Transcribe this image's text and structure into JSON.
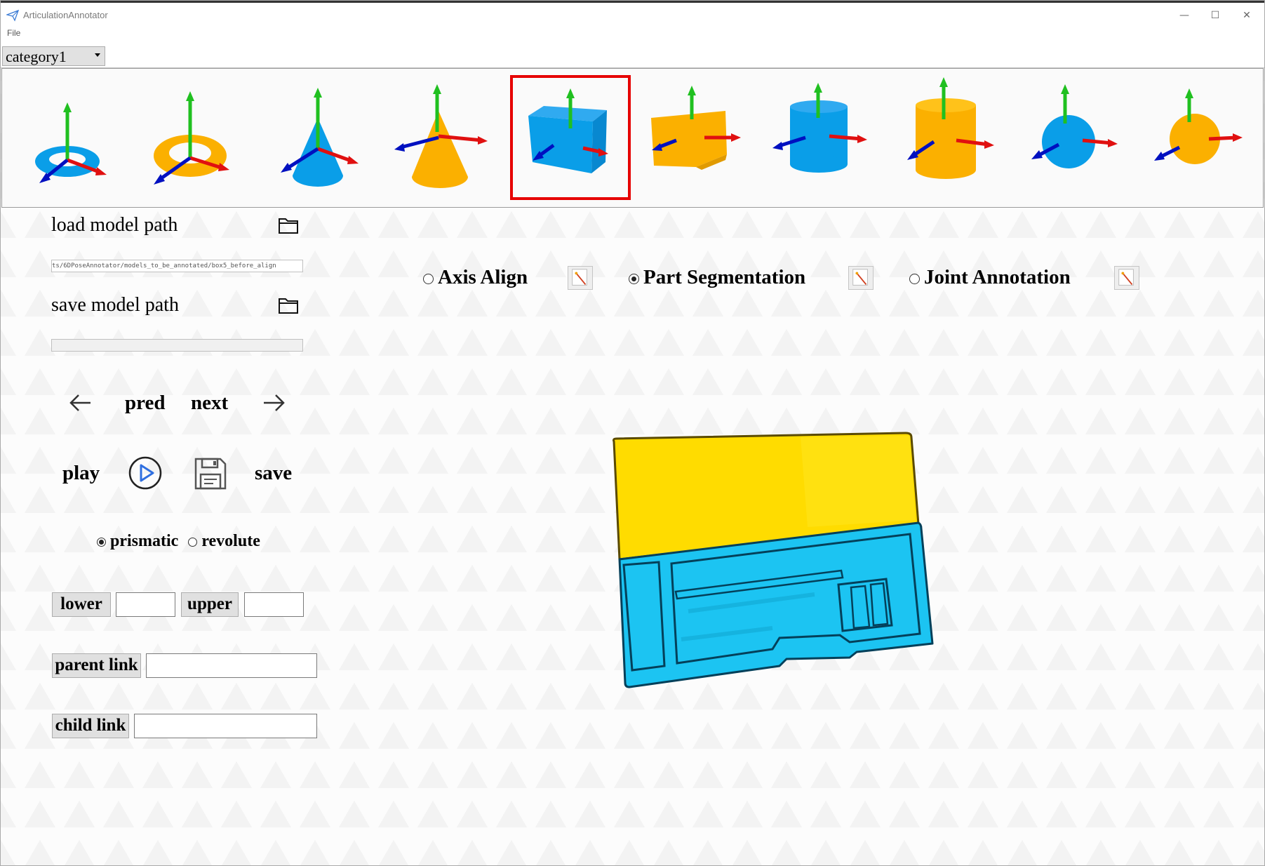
{
  "window": {
    "title": "ArticulationAnnotator",
    "controls": {
      "minimize": "—",
      "maximize": "☐",
      "close": "✕"
    }
  },
  "menu": {
    "file": "File"
  },
  "category": {
    "selected": "category1"
  },
  "shapes": [
    {
      "name": "torus",
      "color": "#0a9ee8"
    },
    {
      "name": "torus",
      "color": "#fbb000"
    },
    {
      "name": "cone",
      "color": "#0a9ee8"
    },
    {
      "name": "cone",
      "color": "#fbb000"
    },
    {
      "name": "cube",
      "color": "#0a9ee8",
      "selected": true
    },
    {
      "name": "cube",
      "color": "#fbb000"
    },
    {
      "name": "cylinder",
      "color": "#0a9ee8"
    },
    {
      "name": "cylinder",
      "color": "#fbb000"
    },
    {
      "name": "sphere",
      "color": "#0a9ee8"
    },
    {
      "name": "sphere",
      "color": "#fbb000"
    }
  ],
  "left_panel": {
    "load_label": "load model path",
    "load_path": "ts/6DPoseAnnotator/models_to_be_annotated/box5_before_align",
    "save_label": "save model path",
    "save_path": "",
    "pred_label": "pred",
    "next_label": "next",
    "play_label": "play",
    "save_btn_label": "save",
    "joint_types": [
      {
        "label": "prismatic",
        "checked": true
      },
      {
        "label": "revolute",
        "checked": false
      }
    ],
    "lower_label": "lower",
    "lower_value": "",
    "upper_label": "upper",
    "upper_value": "",
    "parent_link_label": "parent link",
    "parent_link_value": "",
    "child_link_label": "child link",
    "child_link_value": ""
  },
  "modes": [
    {
      "label": "Axis Align",
      "checked": false
    },
    {
      "label": "Part Segmentation",
      "checked": true
    },
    {
      "label": "Joint Annotation",
      "checked": false
    }
  ],
  "colors": {
    "part_blue": "#1cc4f2",
    "part_yellow": "#ffdc00",
    "selection": "#e60000"
  }
}
